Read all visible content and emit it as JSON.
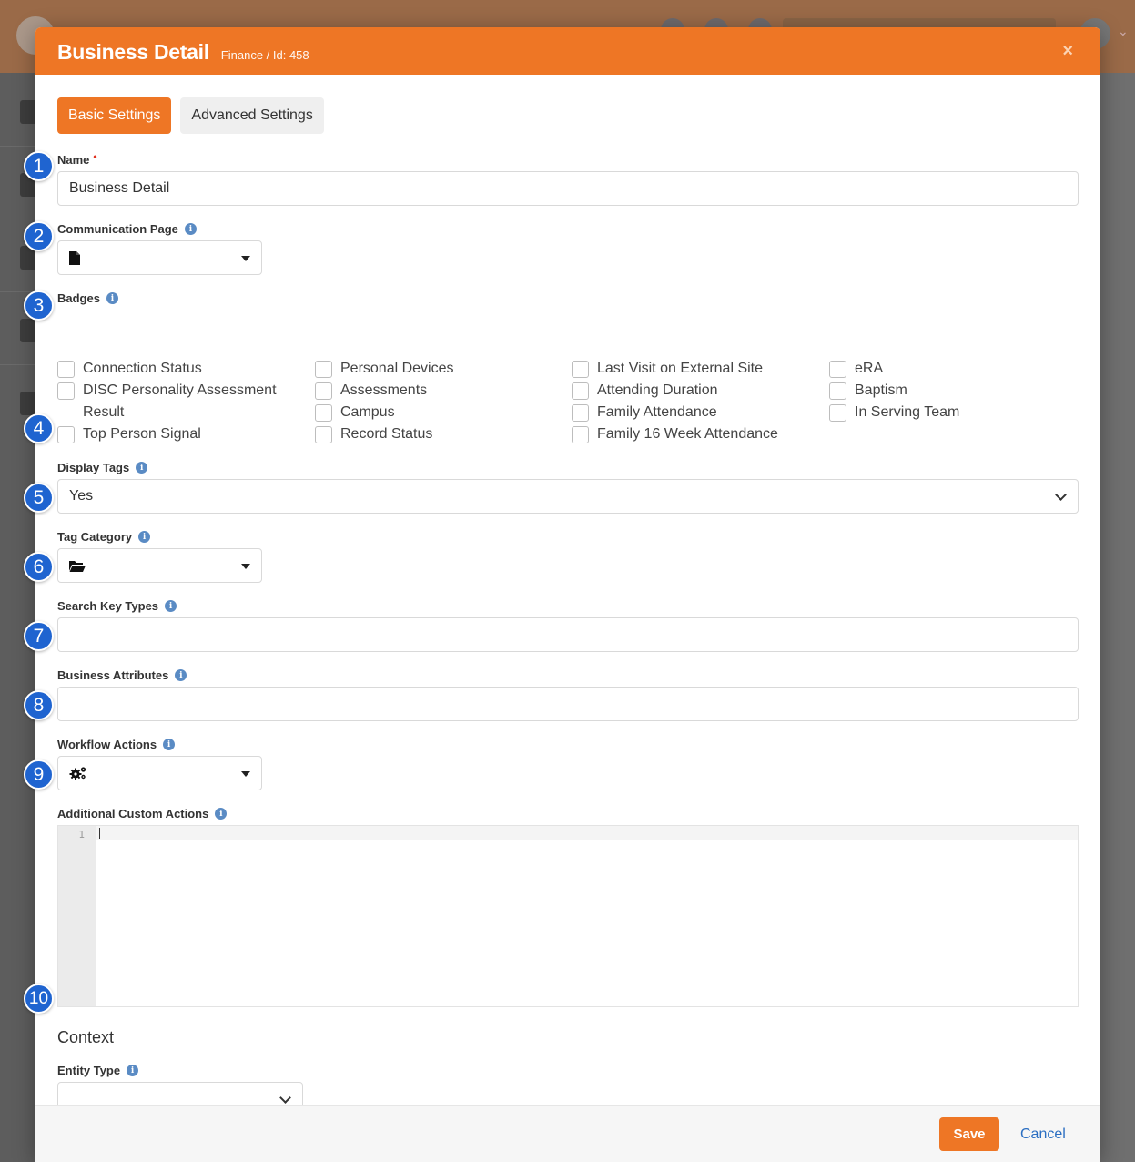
{
  "modal": {
    "title": "Business Detail",
    "subtitle": "Finance / Id: 458",
    "close": "×"
  },
  "tabs": [
    {
      "label": "Basic Settings",
      "active": true
    },
    {
      "label": "Advanced Settings",
      "active": false
    }
  ],
  "fields": {
    "name": {
      "label": "Name",
      "required_mark": "•",
      "value": "Business Detail"
    },
    "communication_page": {
      "label": "Communication Page",
      "icon": "file-icon"
    },
    "badges": {
      "label": "Badges",
      "items": [
        {
          "label": "Connection Status",
          "checked": false
        },
        {
          "label": "DISC Personality Assessment Result",
          "checked": false
        },
        {
          "label": "Top Person Signal",
          "checked": false
        },
        {
          "label": "Personal Devices",
          "checked": false
        },
        {
          "label": "Assessments",
          "checked": false
        },
        {
          "label": "Campus",
          "checked": false
        },
        {
          "label": "Record Status",
          "checked": false
        },
        {
          "label": "Last Visit on External Site",
          "checked": false
        },
        {
          "label": "Attending Duration",
          "checked": false
        },
        {
          "label": "Family Attendance",
          "checked": false
        },
        {
          "label": "Family 16 Week Attendance",
          "checked": false
        },
        {
          "label": "eRA",
          "checked": false
        },
        {
          "label": "Baptism",
          "checked": false
        },
        {
          "label": "In Serving Team",
          "checked": false
        }
      ]
    },
    "display_tags": {
      "label": "Display Tags",
      "value": "Yes"
    },
    "tag_category": {
      "label": "Tag Category",
      "icon": "folder-open-icon"
    },
    "search_key_types": {
      "label": "Search Key Types",
      "value": ""
    },
    "business_attributes": {
      "label": "Business Attributes",
      "value": ""
    },
    "workflow_actions": {
      "label": "Workflow Actions",
      "icon": "gears-icon"
    },
    "additional_custom_actions": {
      "label": "Additional Custom Actions",
      "line_number": "1"
    },
    "context": {
      "heading": "Context"
    },
    "entity_type": {
      "label": "Entity Type",
      "value": ""
    }
  },
  "callouts": [
    "1",
    "2",
    "3",
    "4",
    "5",
    "6",
    "7",
    "8",
    "9",
    "10"
  ],
  "footer": {
    "save_label": "Save",
    "cancel_label": "Cancel"
  },
  "colors": {
    "accent": "#ee7625",
    "callout": "#1f64d0",
    "link": "#2a6ec2",
    "info": "#5a8bc4"
  }
}
